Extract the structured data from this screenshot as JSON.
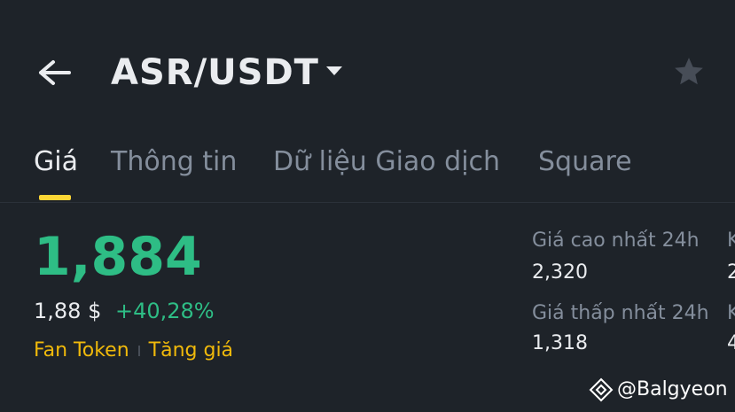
{
  "header": {
    "pair": "ASR/USDT",
    "back_icon": "arrow-left-icon",
    "dropdown_icon": "caret-down-icon",
    "favorite_icon": "star-icon"
  },
  "tabs": [
    {
      "label": "Giá",
      "active": true
    },
    {
      "label": "Thông tin",
      "active": false
    },
    {
      "label": "Dữ liệu Giao dịch",
      "active": false
    },
    {
      "label": "Square",
      "active": false
    }
  ],
  "price": {
    "last": "1,884",
    "fiat": "1,88 $",
    "change_pct": "+40,28%"
  },
  "tags": [
    "Fan Token",
    "Tăng giá"
  ],
  "stats": {
    "high_label": "Giá cao nhất 24h",
    "high_value": "2,320",
    "low_label": "Giá thấp nhất 24h",
    "low_value": "1,318",
    "right_label_1": "K",
    "right_value_1": "2",
    "right_label_2": "K",
    "right_value_2": "4"
  },
  "watermark": {
    "text": "@Balgyeon"
  },
  "colors": {
    "background": "#1e2329",
    "up": "#2ebd85",
    "accent": "#fcd535",
    "tag": "#f0b90b",
    "muted": "#848e9c"
  }
}
